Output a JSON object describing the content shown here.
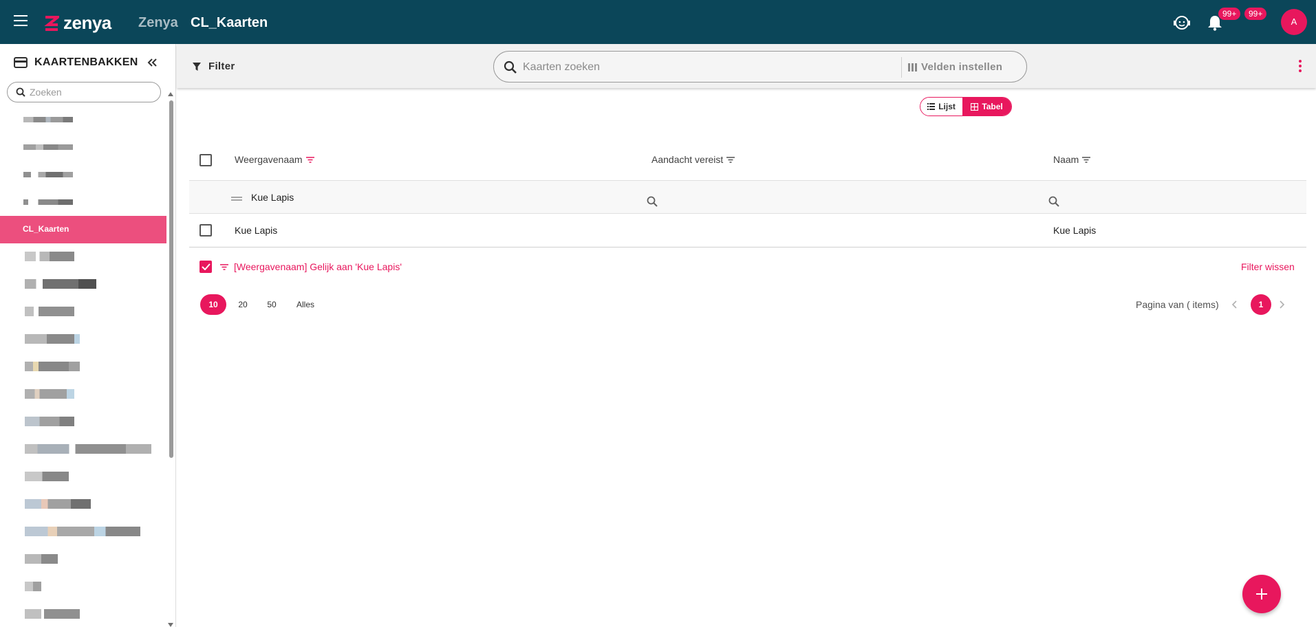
{
  "header": {
    "logo_text": "zenya",
    "app_name": "Zenya",
    "page_title": "CL_Kaarten",
    "badges": [
      "99+",
      "99+"
    ],
    "avatar_initial": "A",
    "colors": {
      "bar": "#0b4659",
      "accent": "#e8175d"
    }
  },
  "sidebar": {
    "title": "KAARTENBAKKEN",
    "search_placeholder": "Zoeken",
    "active_item": "CL_Kaarten"
  },
  "toolbar": {
    "filter_label": "Filter",
    "search_placeholder": "Kaarten zoeken",
    "fields_label": "Velden instellen"
  },
  "view_toggle": {
    "list_label": "Lijst",
    "table_label": "Tabel",
    "selected": "Tabel"
  },
  "table": {
    "columns": [
      "Weergavenaam",
      "Aandacht vereist",
      "Naam"
    ],
    "filter_row": {
      "weergavenaam": "Kue Lapis"
    },
    "rows": [
      {
        "weergavenaam": "Kue Lapis",
        "aandacht": "",
        "naam": "Kue Lapis"
      }
    ],
    "active_filter": "[Weergavenaam] Gelijk aan 'Kue Lapis'",
    "clear_filter_label": "Filter wissen"
  },
  "pagination": {
    "sizes": [
      "10",
      "20",
      "50",
      "Alles"
    ],
    "selected_size": "10",
    "info": "Pagina van ( items)",
    "current_page": "1"
  }
}
